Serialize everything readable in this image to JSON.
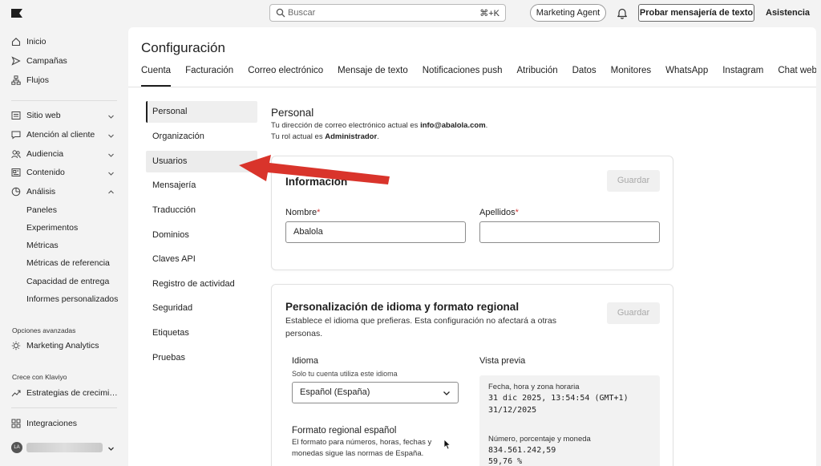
{
  "topbar": {
    "search_placeholder": "Buscar",
    "search_shortcut": "⌘+K",
    "marketing_agent": "Marketing Agent",
    "try_sms": "Probar mensajería de texto",
    "help": "Asistencia"
  },
  "sidebar": {
    "primary": [
      {
        "label": "Inicio",
        "icon": "home-icon"
      },
      {
        "label": "Campañas",
        "icon": "send-icon"
      },
      {
        "label": "Flujos",
        "icon": "flow-icon"
      }
    ],
    "groups": [
      {
        "label": "Sitio web",
        "icon": "website-icon"
      },
      {
        "label": "Atención al cliente",
        "icon": "chat-icon"
      },
      {
        "label": "Audiencia",
        "icon": "audience-icon"
      },
      {
        "label": "Contenido",
        "icon": "content-icon"
      },
      {
        "label": "Análisis",
        "icon": "analytics-icon"
      }
    ],
    "analytics_sub": [
      "Paneles",
      "Experimentos",
      "Métricas",
      "Métricas de referencia",
      "Capacidad de entrega",
      "Informes personalizados"
    ],
    "advanced_heading": "Opciones avanzadas",
    "advanced_item": "Marketing Analytics",
    "grow_heading": "Crece con Klaviyo",
    "grow_item": "Estrategias de crecimi…",
    "integrations": "Integraciones",
    "avatar_initials": "LA"
  },
  "main": {
    "title": "Configuración",
    "tabs": [
      "Cuenta",
      "Facturación",
      "Correo electrónico",
      "Mensaje de texto",
      "Notificaciones push",
      "Atribución",
      "Datos",
      "Monitores",
      "WhatsApp",
      "Instagram",
      "Chat web"
    ]
  },
  "settings_menu": [
    "Personal",
    "Organización",
    "Usuarios",
    "Mensajería",
    "Traducción",
    "Dominios",
    "Claves API",
    "Registro de actividad",
    "Seguridad",
    "Etiquetas",
    "Pruebas"
  ],
  "personal": {
    "title": "Personal",
    "email_prefix": "Tu dirección de correo electrónico actual es ",
    "email": "info@abalola.com",
    "email_suffix": ".",
    "role_prefix": "Tu rol actual es ",
    "role": "Administrador",
    "role_suffix": "."
  },
  "info_card": {
    "title": "Información",
    "save": "Guardar",
    "first_name_label": "Nombre",
    "first_name_value": "Abalola",
    "last_name_label": "Apellidos",
    "last_name_value": "",
    "required_mark": "*"
  },
  "locale_card": {
    "title": "Personalización de idioma y formato regional",
    "desc_line1": "Establece el idioma que prefieras. Esta configuración no afectará a otras",
    "desc_line2": "personas.",
    "save": "Guardar",
    "language_label": "Idioma",
    "language_hint": "Solo tu cuenta utiliza este idioma",
    "language_value": "Español (España)",
    "preview_label": "Vista previa",
    "regional_title": "Formato regional español",
    "regional_desc_line1": "El formato para números, horas, fechas y",
    "regional_desc_line2": "monedas sigue las normas de España.",
    "preview_dt_label": "Fecha, hora y zona horaria",
    "preview_dt_line1": "31 dic 2025, 13:54:54 (GMT+1)",
    "preview_dt_line2": "31/12/2025",
    "preview_num_label": "Número, porcentaje y moneda",
    "preview_num_line1": "834.561.242,59",
    "preview_num_line2": "59,76 %"
  },
  "colors": {
    "accent": "#1f1f1f",
    "required": "#d13b3b",
    "annotation_arrow": "#d9342b"
  }
}
